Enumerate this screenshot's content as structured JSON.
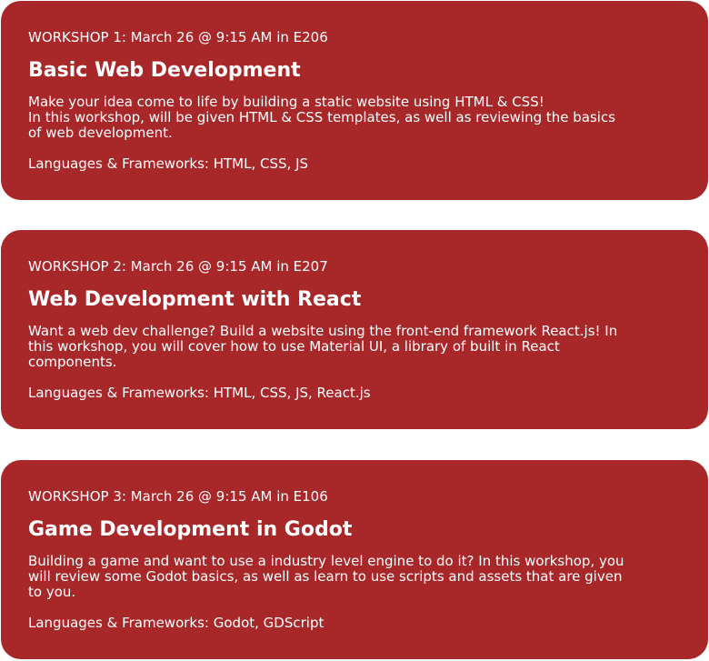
{
  "workshops": [
    {
      "meta": "WORKSHOP 1: March 26 @ 9:15 AM in E206",
      "title": "Basic Web Development",
      "description": [
        "Make your idea come to life by building a static website using HTML & CSS!",
        "In this workshop, will be given HTML & CSS templates, as well as reviewing the basics of web development."
      ],
      "languages": "Languages & Frameworks: HTML, CSS, JS"
    },
    {
      "meta": "WORKSHOP 2: March 26 @ 9:15 AM in E207",
      "title": "Web Development with React",
      "description": [
        "Want a web dev challenge? Build a website using the front-end framework React.js! In this workshop, you will cover how to use Material UI, a library of built in React components."
      ],
      "languages": "Languages & Frameworks: HTML, CSS, JS, React.js"
    },
    {
      "meta": "WORKSHOP 3: March 26 @ 9:15 AM in E106",
      "title": "Game Development in Godot",
      "description": [
        "Building a game and want to use a industry level engine to do it? In this workshop, you will review some Godot basics, as well as learn to use scripts and assets that are given to you."
      ],
      "languages": "Languages & Frameworks: Godot, GDScript"
    }
  ],
  "colors": {
    "card_background": "#a8282a",
    "text": "#ffffff"
  }
}
